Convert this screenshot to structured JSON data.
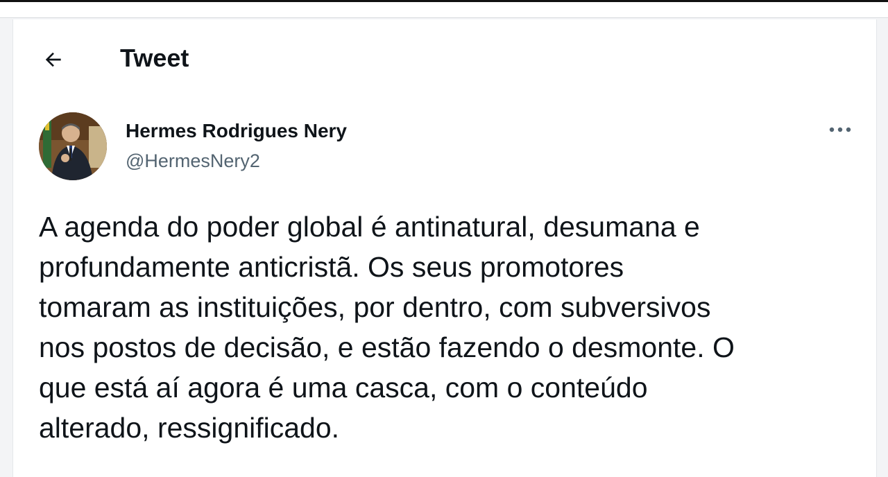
{
  "header": {
    "title": "Tweet"
  },
  "tweet": {
    "author_name": "Hermes Rodrigues Nery",
    "author_handle": "@HermesNery2",
    "text": "A agenda do poder global é antinatural, desumana e\nprofundamente anticristã. Os seus promotores\ntomaram as instituições, por dentro, com subversivos\nnos postos de decisão, e estão fazendo o desmonte. O\nque está aí agora é uma casca, com o conteúdo\nalterado, ressignificado."
  },
  "icons": {
    "back": "arrow-left-icon",
    "more": "more-horizontal-icon"
  },
  "colors": {
    "primary_text": "#0f1419",
    "secondary_text": "#536471"
  }
}
